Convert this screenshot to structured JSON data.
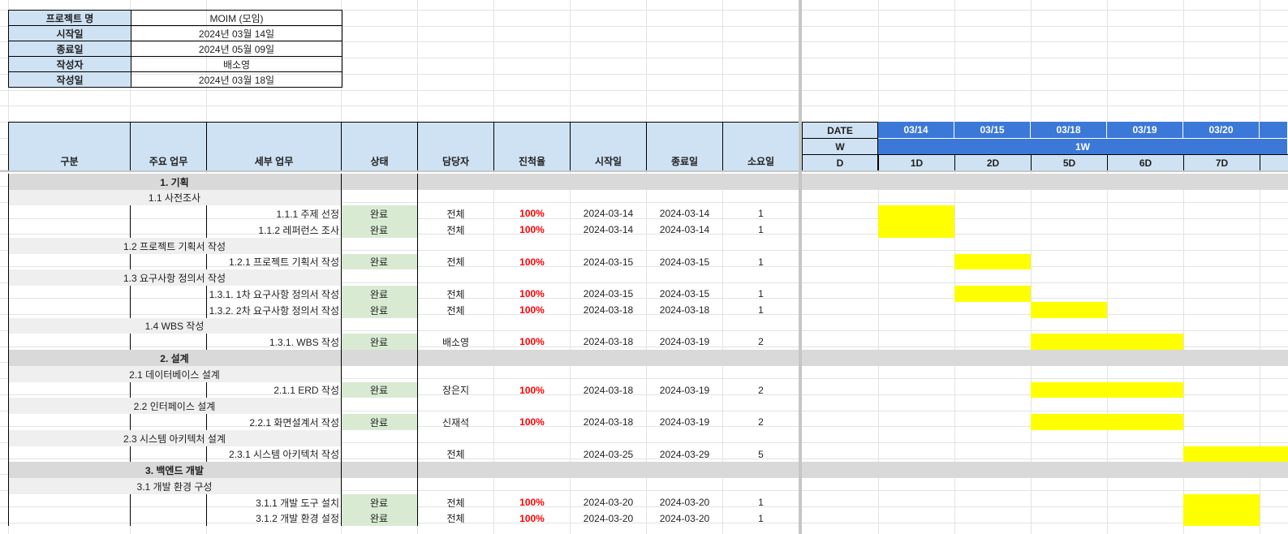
{
  "project_info": [
    {
      "label": "프로젝트 명",
      "value": "MOIM (모임)"
    },
    {
      "label": "시작일",
      "value": "2024년 03월 14일"
    },
    {
      "label": "종료일",
      "value": "2024년 05월 09일"
    },
    {
      "label": "작성자",
      "value": "배소영"
    },
    {
      "label": "작성일",
      "value": "2024년 03월 18일"
    }
  ],
  "table_headers": {
    "category": "구분",
    "main_task": "주요 업무",
    "sub_task": "세부 업무",
    "status": "상태",
    "assignee": "담당자",
    "progress": "진척율",
    "start": "시작일",
    "end": "종료일",
    "duration": "소요일"
  },
  "gantt_header": {
    "date_label": "DATE",
    "week_label": "W",
    "day_label": "D",
    "dates": [
      "03/14",
      "03/15",
      "03/18",
      "03/19",
      "03/20"
    ],
    "week": "1W",
    "days": [
      "1D",
      "2D",
      "5D",
      "6D",
      "7D"
    ]
  },
  "rows": [
    {
      "type": "major",
      "label": "1.  기획"
    },
    {
      "type": "minor",
      "label": "1.1 사전조사"
    },
    {
      "type": "task",
      "label": "1.1.1 주제 선정",
      "status": "완료",
      "assignee": "전체",
      "progress": "100%",
      "start": "2024-03-14",
      "end": "2024-03-14",
      "duration": "1",
      "bars": [
        0,
        1
      ]
    },
    {
      "type": "task",
      "label": "1.1.2 레퍼런스 조사",
      "status": "완료",
      "assignee": "전체",
      "progress": "100%",
      "start": "2024-03-14",
      "end": "2024-03-14",
      "duration": "1",
      "bars": [
        0,
        1
      ]
    },
    {
      "type": "minor",
      "label": "1.2 프로젝트 기획서 작성"
    },
    {
      "type": "task",
      "label": "1.2.1 프로젝트 기획서 작성",
      "status": "완료",
      "assignee": "전체",
      "progress": "100%",
      "start": "2024-03-15",
      "end": "2024-03-15",
      "duration": "1",
      "bars": [
        1,
        2
      ]
    },
    {
      "type": "minor",
      "label": "1.3 요구사항 정의서 작성"
    },
    {
      "type": "task",
      "label": "1.3.1. 1차 요구사항 정의서 작성",
      "status": "완료",
      "assignee": "전체",
      "progress": "100%",
      "start": "2024-03-15",
      "end": "2024-03-15",
      "duration": "1",
      "bars": [
        1,
        2
      ]
    },
    {
      "type": "task",
      "label": "1.3.2. 2차 요구사항 정의서 작성",
      "status": "완료",
      "assignee": "전체",
      "progress": "100%",
      "start": "2024-03-18",
      "end": "2024-03-18",
      "duration": "1",
      "bars": [
        2,
        3
      ]
    },
    {
      "type": "minor",
      "label": "1.4 WBS 작성"
    },
    {
      "type": "task",
      "label": "1.3.1. WBS 작성",
      "status": "완료",
      "assignee": "배소영",
      "progress": "100%",
      "start": "2024-03-18",
      "end": "2024-03-19",
      "duration": "2",
      "bars": [
        2,
        4
      ]
    },
    {
      "type": "major",
      "label": "2.  설계"
    },
    {
      "type": "minor",
      "label": "2.1 데이터베이스 설계"
    },
    {
      "type": "task",
      "label": "2.1.1 ERD 작성",
      "status": "완료",
      "assignee": "장은지",
      "progress": "100%",
      "start": "2024-03-18",
      "end": "2024-03-19",
      "duration": "2",
      "bars": [
        2,
        4
      ]
    },
    {
      "type": "minor",
      "label": "2.2 인터페이스 설계"
    },
    {
      "type": "task",
      "label": "2.2.1 화면설계서 작성",
      "status": "완료",
      "assignee": "신재석",
      "progress": "100%",
      "start": "2024-03-18",
      "end": "2024-03-19",
      "duration": "2",
      "bars": [
        2,
        4
      ]
    },
    {
      "type": "minor",
      "label": "2.3 시스템 아키텍처 설계"
    },
    {
      "type": "task",
      "label": "2.3.1 시스템 아키텍처 작성",
      "status": "",
      "assignee": "전체",
      "progress": "",
      "start": "2024-03-25",
      "end": "2024-03-29",
      "duration": "5",
      "bars": [
        4,
        6
      ]
    },
    {
      "type": "major",
      "label": "3. 백엔드 개발"
    },
    {
      "type": "minor",
      "label": "3.1  개발 환경 구성"
    },
    {
      "type": "task",
      "label": "3.1.1 개발 도구 설치",
      "status": "완료",
      "assignee": "전체",
      "progress": "100%",
      "start": "2024-03-20",
      "end": "2024-03-20",
      "duration": "1",
      "bars": [
        4,
        5
      ]
    },
    {
      "type": "task",
      "label": "3.1.2 개발 환경 설정",
      "status": "완료",
      "assignee": "전체",
      "progress": "100%",
      "start": "2024-03-20",
      "end": "2024-03-20",
      "duration": "1",
      "bars": [
        4,
        5
      ]
    }
  ]
}
